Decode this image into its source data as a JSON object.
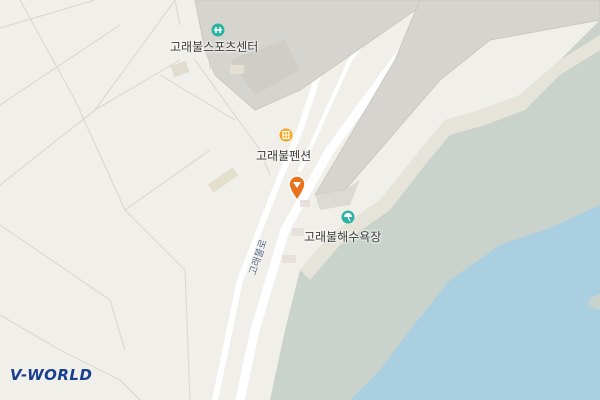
{
  "map": {
    "colors": {
      "land": "#f1efe9",
      "building": "#d6d4ce",
      "sea": "#aacfe0",
      "beach": "#c9d3cc",
      "road_label": "#5a6a86"
    },
    "pois": [
      {
        "label": "고래불스포츠센터",
        "icon": "sports-center-icon",
        "icon_color": "#2bb3a3"
      },
      {
        "label": "고래불펜션",
        "icon": "pension-icon",
        "icon_color": "#f3a81e"
      },
      {
        "label": "고래불해수욕장",
        "icon": "beach-umbrella-icon",
        "icon_color": "#2bb3a3"
      }
    ],
    "road_label": "고래불로",
    "marker": {
      "icon": "location-pin-icon",
      "color": "#e8731a"
    }
  },
  "branding": {
    "logo_text": "V-WORLD"
  }
}
